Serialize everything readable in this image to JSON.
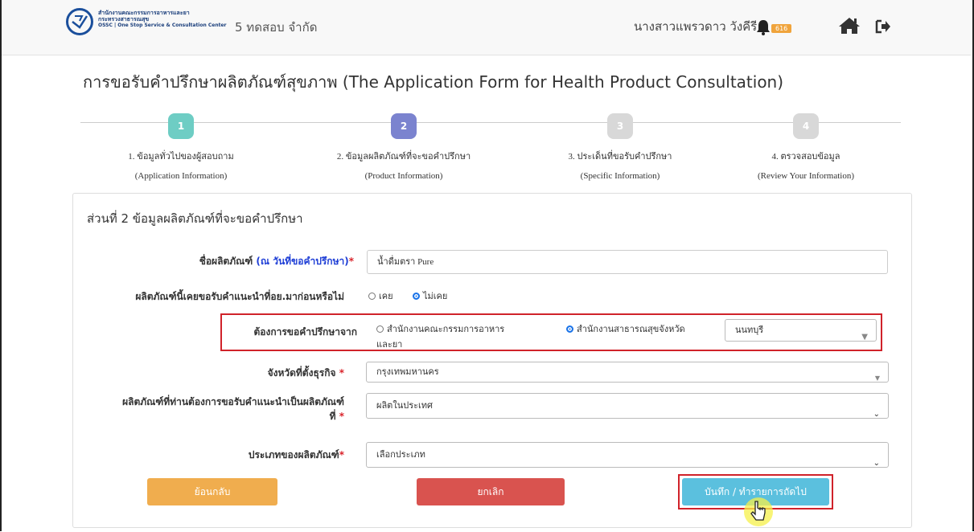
{
  "header": {
    "org_line1": "สำนักงานคณะกรรมการอาหารและยา",
    "org_line2": "กระทรวงสาธารณสุข",
    "org_line3": "OSSC | One Stop Service & Consultation Center",
    "company": "5 ทดสอบ จำกัด",
    "user_name": "นางสาวแพรวดาว วังคีรี",
    "notification_count": "616",
    "badge_color": "#f0a43c"
  },
  "page_title": "การขอรับคำปรึกษาผลิตภัณฑ์สุขภาพ (The Application Form for Health Product Consultation)",
  "steps": [
    {
      "num": "1",
      "label": "1. ข้อมูลทั่วไปของผู้สอบถาม",
      "sub": "(Application Information)",
      "color": "#6ecdc4"
    },
    {
      "num": "2",
      "label": "2. ข้อมูลผลิตภัณฑ์ที่จะขอคำปรึกษา",
      "sub": "(Product Information)",
      "color": "#7b83cf"
    },
    {
      "num": "3",
      "label": "3. ประเด็นที่ขอรับคำปรึกษา",
      "sub": "(Specific Information)",
      "color": "#d8d8d8"
    },
    {
      "num": "4",
      "label": "4. ตรวจสอบข้อมูล",
      "sub": "(Review Your Information)",
      "color": "#d8d8d8"
    }
  ],
  "section_title": "ส่วนที่ 2 ข้อมูลผลิตภัณฑ์ที่จะขอคำปรึกษา",
  "form": {
    "product_name_label": "ชื่อผลิตภัณฑ์",
    "product_name_hint": "(ณ วันที่ขอคำปรึกษา)",
    "product_name_value": "น้ำดื่มตรา Pure",
    "prior_advice_label": "ผลิตภัณฑ์นี้เคยขอรับคำแนะนำที่อย.มาก่อนหรือไม่",
    "prior_advice_options": [
      "เคย",
      "ไม่เคย"
    ],
    "prior_advice_selected": "ไม่เคย",
    "consult_from_label": "ต้องการขอคำปรึกษาจาก",
    "consult_from_option1_line1": "สำนักงานคณะกรรมการอาหาร",
    "consult_from_option1_line2": "และยา",
    "consult_from_option2": "สำนักงานสาธารณสุขจังหวัด",
    "consult_province_value": "นนทบุรี",
    "business_province_label": "จังหวัดที่ตั้งธุรกิจ",
    "business_province_value": "กรุงเทพมหานคร",
    "origin_label_line1": "ผลิตภัณฑ์ที่ท่านต้องการขอรับคำแนะนำเป็นผลิตภัณฑ์",
    "origin_label_line2": "ที่",
    "origin_value": "ผลิตในประเทศ",
    "type_label": "ประเภทของผลิตภัณฑ์",
    "type_value": "เลือกประเภท",
    "required_mark": "*"
  },
  "buttons": {
    "back": "ย้อนกลับ",
    "cancel": "ยกเลิก",
    "save_next": "บันทึก / ทำรายการถัดไป",
    "back_color": "#f0ad4e",
    "cancel_color": "#d9534f",
    "save_color": "#5bc0de"
  }
}
